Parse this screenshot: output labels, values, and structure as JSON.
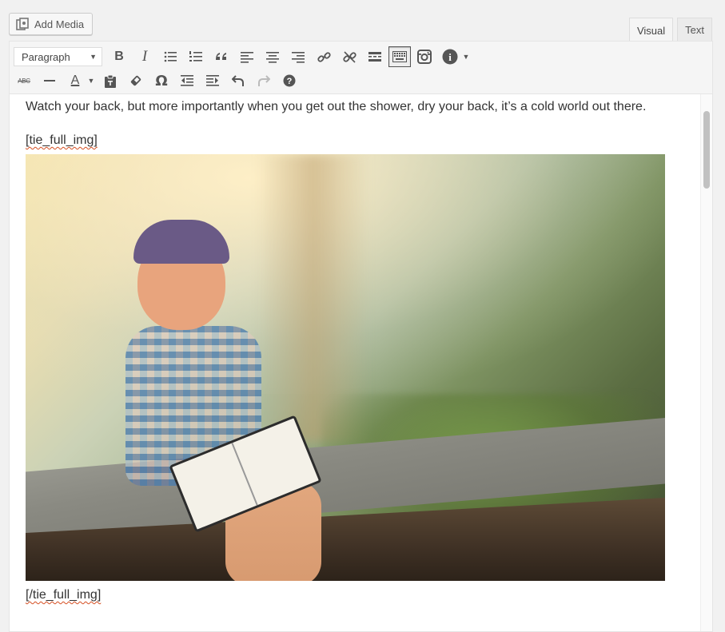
{
  "header": {
    "add_media_label": "Add Media",
    "tabs": [
      {
        "label": "Visual",
        "active": true
      },
      {
        "label": "Text",
        "active": false
      }
    ]
  },
  "toolbar": {
    "format_select_value": "Paragraph",
    "row1_icons": [
      "bold-icon",
      "italic-icon",
      "bulleted-list-icon",
      "numbered-list-icon",
      "blockquote-icon",
      "align-left-icon",
      "align-center-icon",
      "align-right-icon",
      "link-icon",
      "unlink-icon",
      "read-more-icon",
      "toolbar-toggle-icon",
      "instagram-icon",
      "info-icon"
    ],
    "row2_icons": [
      "strikethrough-icon",
      "horizontal-line-icon",
      "text-color-icon",
      "paste-as-text-icon",
      "clear-formatting-icon",
      "special-character-icon",
      "outdent-icon",
      "indent-icon",
      "undo-icon",
      "redo-icon",
      "help-icon"
    ],
    "bold": "B",
    "italic": "I",
    "text_color": "A",
    "strikethrough": "ABC",
    "omega": "Ω",
    "help": "?",
    "info": "i"
  },
  "content": {
    "paragraph": "Watch your back, but more importantly when you get out the shower, dry your back, it’s a cold world out there.",
    "shortcode_open": "[tie_full_img]",
    "shortcode_close": "[/tie_full_img]"
  }
}
